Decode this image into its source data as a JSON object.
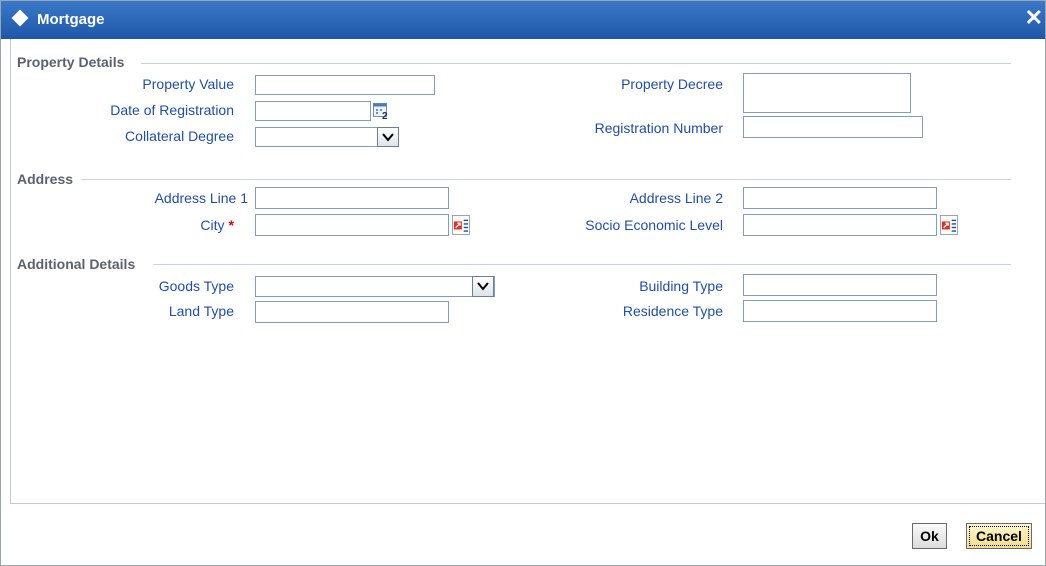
{
  "window": {
    "title": "Mortgage",
    "close_icon": "close-icon"
  },
  "sections": {
    "property": "Property Details",
    "address": "Address",
    "additional": "Additional Details"
  },
  "property": {
    "property_value": {
      "label": "Property Value",
      "value": ""
    },
    "date_of_registration": {
      "label": "Date of Registration",
      "value": ""
    },
    "collateral_degree": {
      "label": "Collateral Degree",
      "value": ""
    },
    "property_decree": {
      "label": "Property Decree",
      "value": ""
    },
    "registration_number": {
      "label": "Registration Number",
      "value": ""
    }
  },
  "address": {
    "address_line_1": {
      "label": "Address Line 1",
      "value": ""
    },
    "address_line_2": {
      "label": "Address Line 2",
      "value": ""
    },
    "city": {
      "label": "City",
      "required_mark": "*",
      "value": ""
    },
    "socio_economic_level": {
      "label": "Socio Economic Level",
      "value": ""
    }
  },
  "additional": {
    "goods_type": {
      "label": "Goods Type",
      "value": ""
    },
    "land_type": {
      "label": "Land Type",
      "value": ""
    },
    "building_type": {
      "label": "Building Type",
      "value": ""
    },
    "residence_type": {
      "label": "Residence Type",
      "value": ""
    }
  },
  "footer": {
    "ok_label": "Ok",
    "cancel_label": "Cancel"
  },
  "colors": {
    "titlebar": "#2a64b8",
    "label": "#1f4ea8",
    "required": "#e00000"
  }
}
